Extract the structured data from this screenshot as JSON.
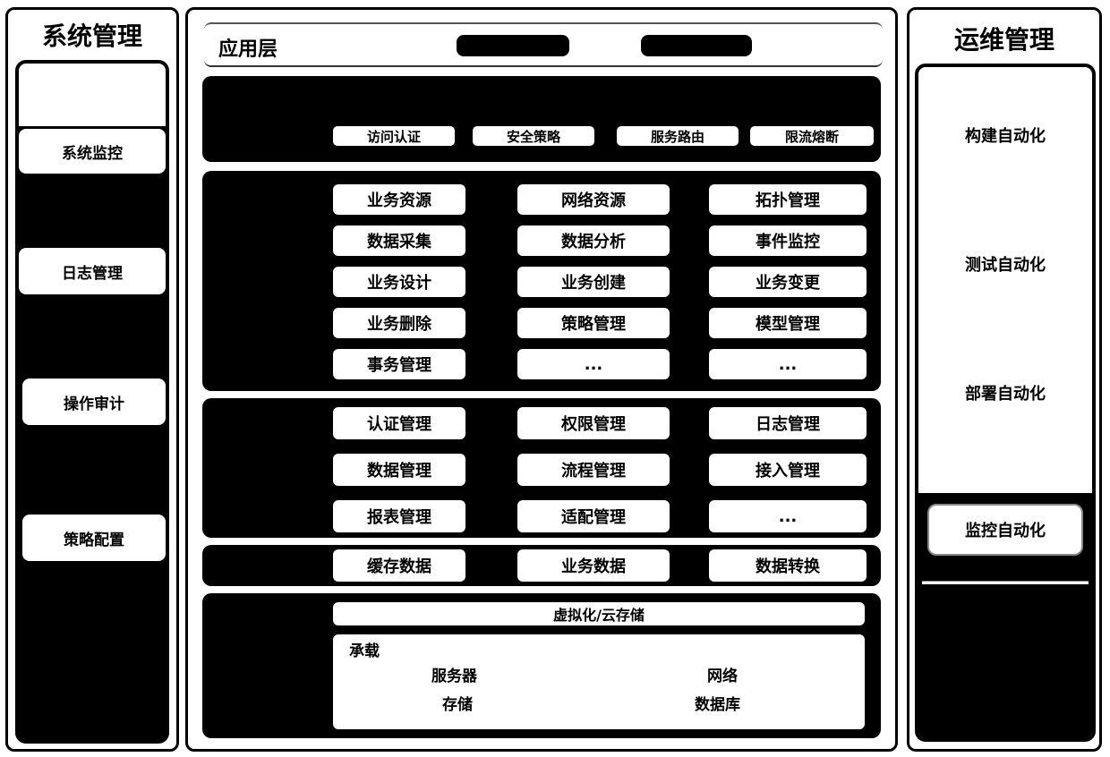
{
  "left_panel": {
    "title": "系统管理",
    "items": [
      {
        "label": "系统监控"
      },
      {
        "label": "日志管理"
      },
      {
        "label": "操作审计"
      },
      {
        "label": "策略配置"
      }
    ]
  },
  "center_panel": {
    "header": {
      "title": "应用层"
    },
    "gateway_row": [
      {
        "label": "访问认证"
      },
      {
        "label": "安全策略"
      },
      {
        "label": "服务路由"
      },
      {
        "label": "限流熔断"
      }
    ],
    "business_grid": [
      [
        "业务资源",
        "网络资源",
        "拓扑管理"
      ],
      [
        "数据采集",
        "数据分析",
        "事件监控"
      ],
      [
        "业务设计",
        "业务创建",
        "业务变更"
      ],
      [
        "业务删除",
        "策略管理",
        "模型管理"
      ],
      [
        "事务管理",
        "...",
        "..."
      ]
    ],
    "platform_grid": [
      [
        "认证管理",
        "权限管理",
        "日志管理"
      ],
      [
        "数据管理",
        "流程管理",
        "接入管理"
      ],
      [
        "报表管理",
        "适配管理",
        "..."
      ]
    ],
    "data_row": [
      "缓存数据",
      "业务数据",
      "数据转换"
    ],
    "infra": {
      "virtualization_label": "虚拟化/云存储",
      "carrier_label": "承载",
      "items": [
        "服务器",
        "网络",
        "存储",
        "数据库"
      ]
    }
  },
  "right_panel": {
    "title": "运维管理",
    "items": [
      {
        "label": "构建自动化"
      },
      {
        "label": "测试自动化"
      },
      {
        "label": "部署自动化"
      },
      {
        "label": "监控自动化"
      }
    ]
  }
}
